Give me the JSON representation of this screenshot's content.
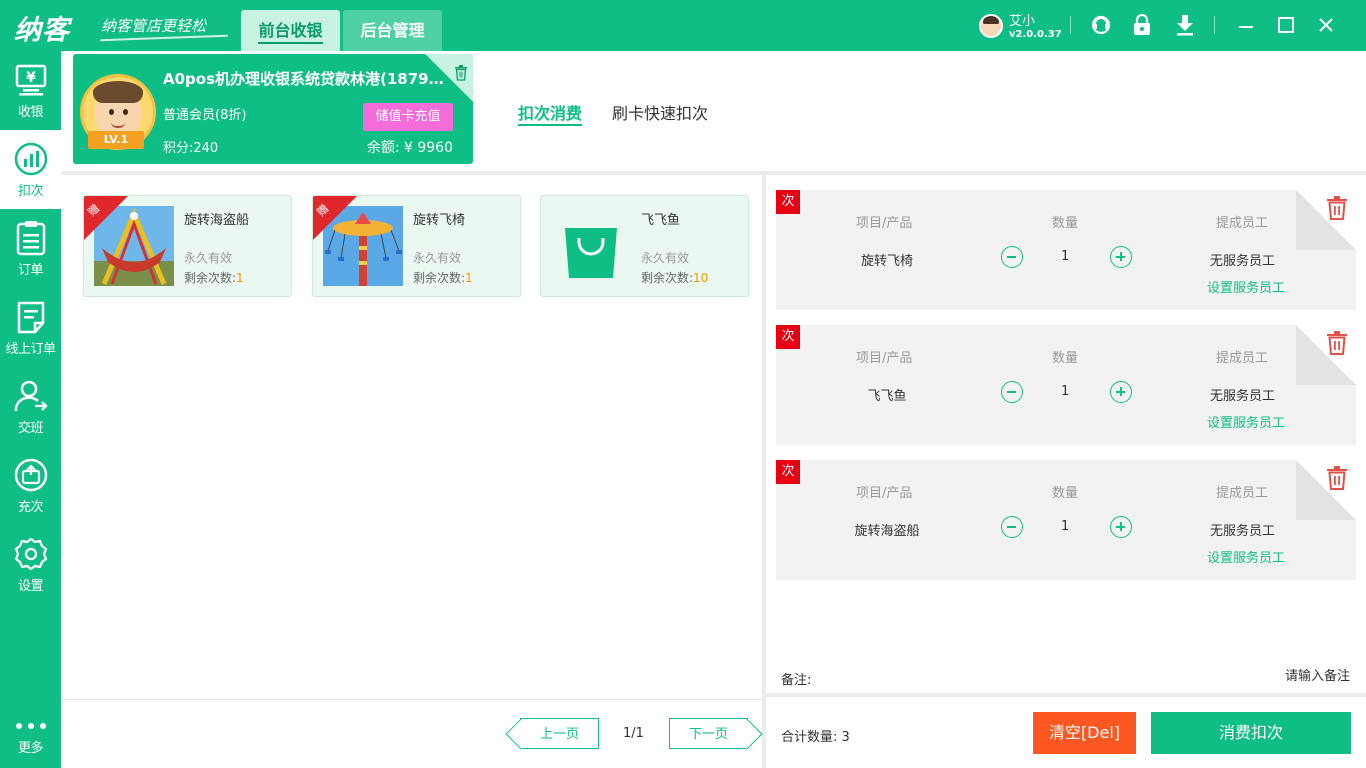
{
  "app": {
    "logo": "纳客",
    "slogan": "纳客管店更轻松",
    "tabs": [
      {
        "label": "前台收银",
        "active": true
      },
      {
        "label": "后台管理",
        "active": false
      }
    ],
    "user": {
      "name": "艾小",
      "version": "v2.0.0.37"
    }
  },
  "sidebar": {
    "items": [
      {
        "label": "收银",
        "icon": "cash-register-icon",
        "active": false
      },
      {
        "label": "扣次",
        "icon": "bar-chart-icon",
        "active": true
      },
      {
        "label": "订单",
        "icon": "order-list-icon",
        "active": false
      },
      {
        "label": "线上订单",
        "icon": "online-order-icon",
        "active": false
      },
      {
        "label": "交班",
        "icon": "shift-handover-icon",
        "active": false
      },
      {
        "label": "充次",
        "icon": "recharge-times-icon",
        "active": false
      },
      {
        "label": "设置",
        "icon": "gear-icon",
        "active": false
      },
      {
        "label": "更多",
        "icon": "more-dots-icon",
        "active": false
      }
    ]
  },
  "member": {
    "name": "A0pos机办理收银系统贷款林港(18795...",
    "level_name": "普通会员(8折)",
    "points": "积分:240",
    "balance": "余额: ¥ 9960",
    "recharge_label": "储值卡充值",
    "lv_badge": "LV.1"
  },
  "content_tabs": [
    {
      "label": "扣次消费",
      "active": true
    },
    {
      "label": "刷卡快速扣次",
      "active": false
    }
  ],
  "products": [
    {
      "name": "旋转海盗船",
      "validity": "永久有效",
      "remain_label": "剩余次数:",
      "remain": "1",
      "gift": "赠",
      "image": "pirate-ship"
    },
    {
      "name": "旋转飞椅",
      "validity": "永久有效",
      "remain_label": "剩余次数:",
      "remain": "1",
      "gift": "赠",
      "image": "swing-chairs"
    },
    {
      "name": "飞飞鱼",
      "validity": "永久有效",
      "remain_label": "剩余次数:",
      "remain": "10",
      "gift": "",
      "image": "shopping-bag"
    }
  ],
  "pagination": {
    "prev": "上一页",
    "next": "下一页",
    "page": "1/1"
  },
  "cart": {
    "header_item": "项目/产品",
    "header_qty": "数量",
    "header_staff": "提成员工",
    "badge": "次",
    "staff_none": "无服务员工",
    "set_staff": "设置服务员工",
    "items": [
      {
        "name": "旋转飞椅",
        "qty": "1"
      },
      {
        "name": "飞飞鱼",
        "qty": "1"
      },
      {
        "name": "旋转海盗船",
        "qty": "1"
      }
    ],
    "note_label": "备注:",
    "note_placeholder": "请输入备注"
  },
  "footer": {
    "total_label": "合计数量:",
    "total": "3",
    "clear_label": "清空[Del]",
    "consume_label": "消费扣次"
  },
  "colors": {
    "primary": "#0fbe84",
    "danger": "#e60012",
    "clear": "#ff5722",
    "recharge": "#f56bd9",
    "count": "#f39800"
  }
}
